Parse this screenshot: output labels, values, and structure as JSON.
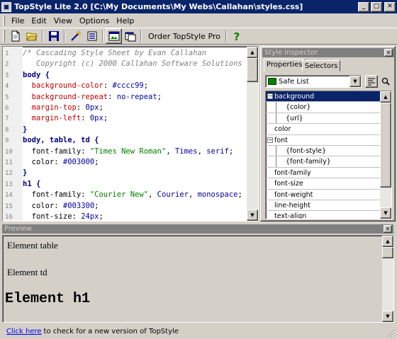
{
  "window": {
    "title": "TopStyle Lite 2.0 [C:\\My Documents\\My Webs\\Callahan\\styles.css]",
    "controls": {
      "minimize": "_",
      "maximize": "□",
      "close": "✕"
    }
  },
  "menu": [
    "File",
    "Edit",
    "View",
    "Options",
    "Help"
  ],
  "toolbar": {
    "icons": [
      "new-file-icon",
      "open-folder-icon",
      "save-icon",
      "wand-icon",
      "list-icon",
      "preview-icon",
      "window-icon",
      "help-icon"
    ],
    "order_label": "Order TopStyle Pro"
  },
  "editor": {
    "lines": [
      {
        "n": "1",
        "parts": [
          [
            "c-comment",
            "/* Cascading Style Sheet by Evan Callahan"
          ]
        ]
      },
      {
        "n": "2",
        "parts": [
          [
            "c-comment",
            "   Copyright (c) 2000 Callahan Software Solutions"
          ]
        ]
      },
      {
        "n": "3",
        "parts": [
          [
            "c-sel",
            "body "
          ],
          [
            "c-brace",
            "{"
          ]
        ]
      },
      {
        "n": "4",
        "parts": [
          [
            "c-txt",
            "  "
          ],
          [
            "c-prop",
            "background-color"
          ],
          [
            "c-txt",
            ": "
          ],
          [
            "c-val",
            "#cccc99"
          ],
          [
            "c-txt",
            ";"
          ]
        ]
      },
      {
        "n": "5",
        "parts": [
          [
            "c-txt",
            "  "
          ],
          [
            "c-prop",
            "background-repeat"
          ],
          [
            "c-txt",
            ": "
          ],
          [
            "c-val",
            "no-repeat"
          ],
          [
            "c-txt",
            ";"
          ]
        ]
      },
      {
        "n": "6",
        "parts": [
          [
            "c-txt",
            "  "
          ],
          [
            "c-prop",
            "margin-top"
          ],
          [
            "c-txt",
            ": "
          ],
          [
            "c-val",
            "0px"
          ],
          [
            "c-txt",
            ";"
          ]
        ]
      },
      {
        "n": "7",
        "parts": [
          [
            "c-txt",
            "  "
          ],
          [
            "c-prop",
            "margin-left"
          ],
          [
            "c-txt",
            ": "
          ],
          [
            "c-val",
            "0px"
          ],
          [
            "c-txt",
            ";"
          ]
        ]
      },
      {
        "n": "8",
        "parts": [
          [
            "c-brace",
            "}"
          ]
        ]
      },
      {
        "n": "9",
        "parts": [
          [
            "c-sel",
            "body, table, td "
          ],
          [
            "c-brace",
            "{"
          ]
        ]
      },
      {
        "n": "10",
        "parts": [
          [
            "c-txt",
            "  "
          ],
          [
            "c-txt",
            "font-family: "
          ],
          [
            "c-str",
            "\"Times New Roman\""
          ],
          [
            "c-txt",
            ", "
          ],
          [
            "c-val",
            "Times"
          ],
          [
            "c-txt",
            ", "
          ],
          [
            "c-val",
            "serif"
          ],
          [
            "c-txt",
            ";"
          ]
        ]
      },
      {
        "n": "11",
        "parts": [
          [
            "c-txt",
            "  color: "
          ],
          [
            "c-val",
            "#003000"
          ],
          [
            "c-txt",
            ";"
          ]
        ]
      },
      {
        "n": "12",
        "parts": [
          [
            "c-brace",
            "}"
          ]
        ]
      },
      {
        "n": "13",
        "parts": [
          [
            "c-sel",
            "h1 "
          ],
          [
            "c-brace",
            "{"
          ]
        ]
      },
      {
        "n": "14",
        "parts": [
          [
            "c-txt",
            "  font-family: "
          ],
          [
            "c-str",
            "\"Courier New\""
          ],
          [
            "c-txt",
            ", "
          ],
          [
            "c-val",
            "Courier"
          ],
          [
            "c-txt",
            ", "
          ],
          [
            "c-val",
            "monospace"
          ],
          [
            "c-txt",
            ";"
          ]
        ]
      },
      {
        "n": "15",
        "parts": [
          [
            "c-txt",
            "  color: "
          ],
          [
            "c-val",
            "#003300"
          ],
          [
            "c-txt",
            ";"
          ]
        ]
      },
      {
        "n": "16",
        "parts": [
          [
            "c-txt",
            "  font-size: "
          ],
          [
            "c-val",
            "24px"
          ],
          [
            "c-txt",
            ";"
          ]
        ]
      }
    ]
  },
  "inspector": {
    "title": "Style Inspector",
    "tabs": [
      "Properties",
      "Selectors"
    ],
    "filter": "Safe List",
    "rows": [
      {
        "label": "background",
        "level": 0,
        "expander": "−",
        "selected": true
      },
      {
        "label": "{color}",
        "level": 1
      },
      {
        "label": "{url}",
        "level": 1
      },
      {
        "label": "color",
        "level": 0
      },
      {
        "label": "font",
        "level": 0,
        "expander": "−"
      },
      {
        "label": "{font-style}",
        "level": 1
      },
      {
        "label": "{font-family}",
        "level": 1
      },
      {
        "label": "font-family",
        "level": 0
      },
      {
        "label": "font-size",
        "level": 0
      },
      {
        "label": "font-weight",
        "level": 0
      },
      {
        "label": "line-height",
        "level": 0
      },
      {
        "label": "text-align",
        "level": 0
      }
    ]
  },
  "preview": {
    "title": "Preview",
    "table_text": "Element table",
    "td_text": "Element td",
    "h1_text": "Element h1"
  },
  "status": {
    "link": "Click here",
    "text": "to check for a new version of TopStyle"
  },
  "colors": {
    "titlebar": "#0a246a",
    "chrome": "#d4d0c8",
    "selection": "#0a246a"
  }
}
